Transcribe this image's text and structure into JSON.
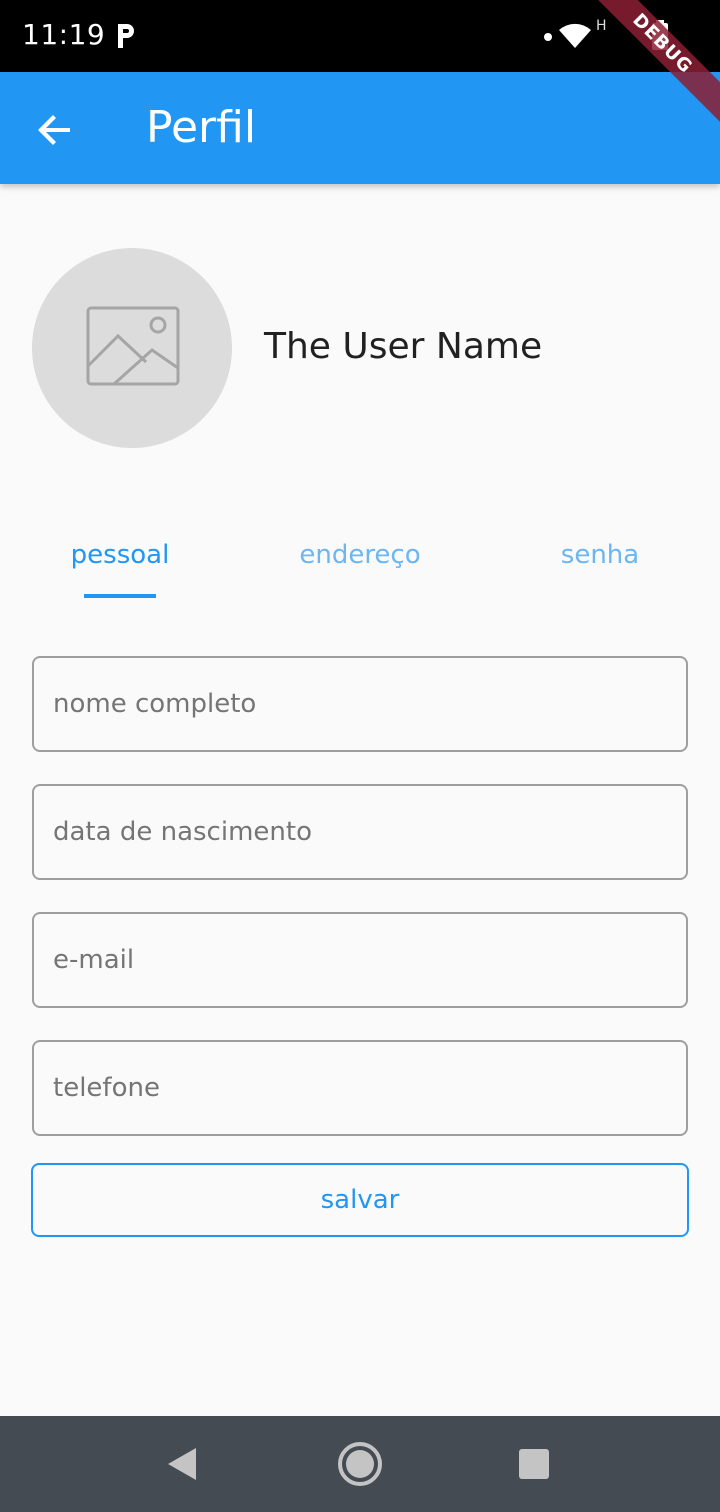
{
  "status_bar": {
    "time": "11:19",
    "network_label": "H",
    "debug_label": "DEBUG"
  },
  "app_bar": {
    "title": "Perfil",
    "back_icon": "arrow-back-icon"
  },
  "profile": {
    "name": "The User Name",
    "avatar_icon": "image-placeholder-icon"
  },
  "tabs": [
    {
      "label": "pessoal",
      "active": true
    },
    {
      "label": "endereço",
      "active": false
    },
    {
      "label": "senha",
      "active": false
    }
  ],
  "form": {
    "full_name_placeholder": "nome completo",
    "birth_date_placeholder": "data de nascimento",
    "email_placeholder": "e-mail",
    "phone_placeholder": "telefone",
    "save_label": "salvar"
  },
  "colors": {
    "primary": "#2196f3",
    "tab_inactive": "#6db6f2",
    "nav_bar": "#454b52"
  }
}
